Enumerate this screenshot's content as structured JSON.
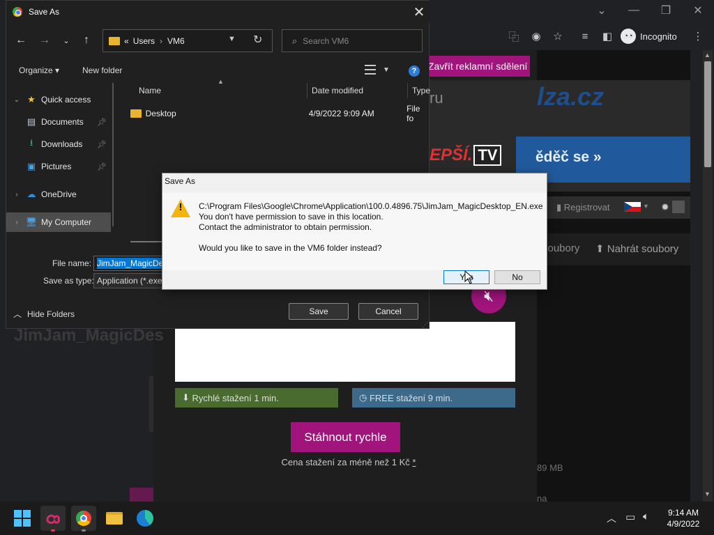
{
  "browser": {
    "window_controls": {
      "tab_search": "⌄",
      "minimize": "—",
      "restore": "❐",
      "close": "✕"
    },
    "toolbar_icons": [
      "translate-icon",
      "eye-off-icon",
      "star-icon",
      "media-icon",
      "sidebar-icon"
    ],
    "incognito_label": "Incognito"
  },
  "webpage": {
    "ad_close": "Zavřít reklamní sdělení",
    "banner_logo": "lza.cz",
    "banner_cta": "ěděč se »",
    "tv_logo_left": "EPŠÍ.",
    "tv_logo_right": "TV",
    "ru_fragment": "ru",
    "register": "Registrovat",
    "files_tab": "soubory",
    "upload": "Nahrát soubory",
    "bg_filename": "JimJam_MagicDes",
    "fast_download": "Rychlé stažení 1 min.",
    "free_download": "FREE stažení 9 min.",
    "download_button": "Stáhnout rychle",
    "price_note": "Cena stažení za méně než 1 Kč",
    "price_asterisk": "*",
    "size": "89 MB",
    "na_fragment": "na"
  },
  "save_dialog": {
    "title": "Save As",
    "address": {
      "prefix": "«",
      "parts": [
        "Users",
        "VM6"
      ]
    },
    "search_placeholder": "Search VM6",
    "organize": "Organize ▾",
    "new_folder": "New folder",
    "nav_items": [
      {
        "label": "Quick access",
        "icon": "star-icon",
        "expandable": true
      },
      {
        "label": "Documents",
        "icon": "documents-icon",
        "pinned": true
      },
      {
        "label": "Downloads",
        "icon": "downloads-icon",
        "pinned": true
      },
      {
        "label": "Pictures",
        "icon": "pictures-icon",
        "pinned": true
      },
      {
        "label": "OneDrive",
        "icon": "cloud-icon",
        "expandable": true
      },
      {
        "label": "My Computer",
        "icon": "computer-icon",
        "expandable": true,
        "selected": true
      }
    ],
    "columns": [
      "Name",
      "Date modified",
      "Type"
    ],
    "files": [
      {
        "name": "Desktop",
        "modified": "4/9/2022 9:09 AM",
        "type": "File fo"
      }
    ],
    "file_name_label": "File name:",
    "file_name_value": "JimJam_MagicDesktop_EN.exe",
    "save_type_label": "Save as type:",
    "save_type_value": "Application (*.exe)",
    "hide_folders": "Hide Folders",
    "save_button": "Save",
    "cancel_button": "Cancel"
  },
  "message_box": {
    "title": "Save As",
    "path": "C:\\Program Files\\Google\\Chrome\\Application\\100.0.4896.75\\JimJam_MagicDesktop_EN.exe",
    "line1": "You don't have permission to save in this location.",
    "line2": "Contact the administrator to obtain permission.",
    "question": "Would you like to save in the VM6 folder instead?",
    "yes": "Yes",
    "no": "No"
  },
  "taskbar": {
    "apps": [
      "windows-start-icon",
      "creative-cloud-icon",
      "chrome-icon",
      "file-explorer-icon",
      "edge-icon"
    ],
    "time": "9:14 AM",
    "date": "4/9/2022"
  },
  "colors": {
    "accent_magenta": "#a0147c",
    "windows_blue": "#0078d7",
    "warning_yellow": "#f2b40e",
    "fast_green": "#4a6b2f",
    "free_blue": "#3d6a8a"
  }
}
